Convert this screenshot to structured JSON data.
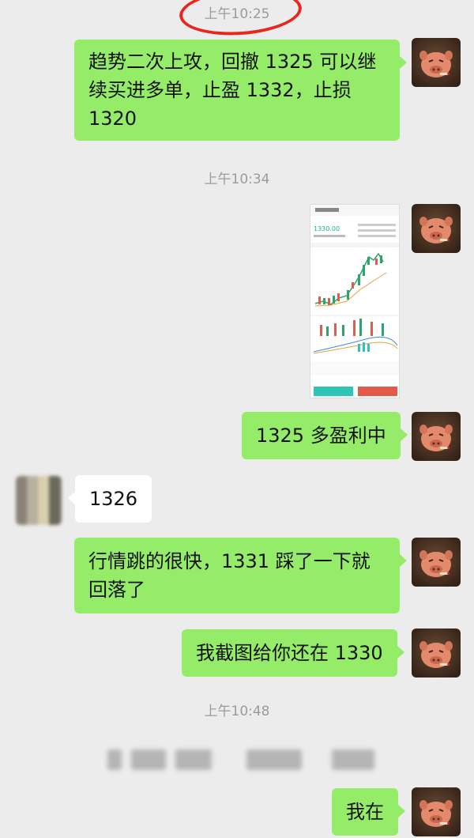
{
  "timestamps": [
    "上午10:25",
    "上午10:34",
    "上午10:48"
  ],
  "messages": [
    {
      "side": "right",
      "text": "趋势二次上攻，回撤 1325 可以继续买进多单，止盈 1332，止损 1320"
    },
    {
      "side": "right",
      "type": "image",
      "app_price": "1330.00"
    },
    {
      "side": "right",
      "text": "1325 多盈利中"
    },
    {
      "side": "left",
      "text": "1326"
    },
    {
      "side": "right",
      "text": "行情跳的很快，1331 踩了一下就回落了"
    },
    {
      "side": "right",
      "text": "我截图给你还在 1330"
    },
    {
      "side": "left",
      "type": "blurred"
    },
    {
      "side": "right",
      "text": "我在"
    }
  ],
  "colors": {
    "bubble_green": "#95ec69",
    "bubble_white": "#ffffff",
    "background": "#ececec",
    "circle_annotation": "#e8261e"
  },
  "icons": {
    "self_avatar": "pig-avatar-icon",
    "other_avatar": "pixelated-avatar-icon"
  }
}
